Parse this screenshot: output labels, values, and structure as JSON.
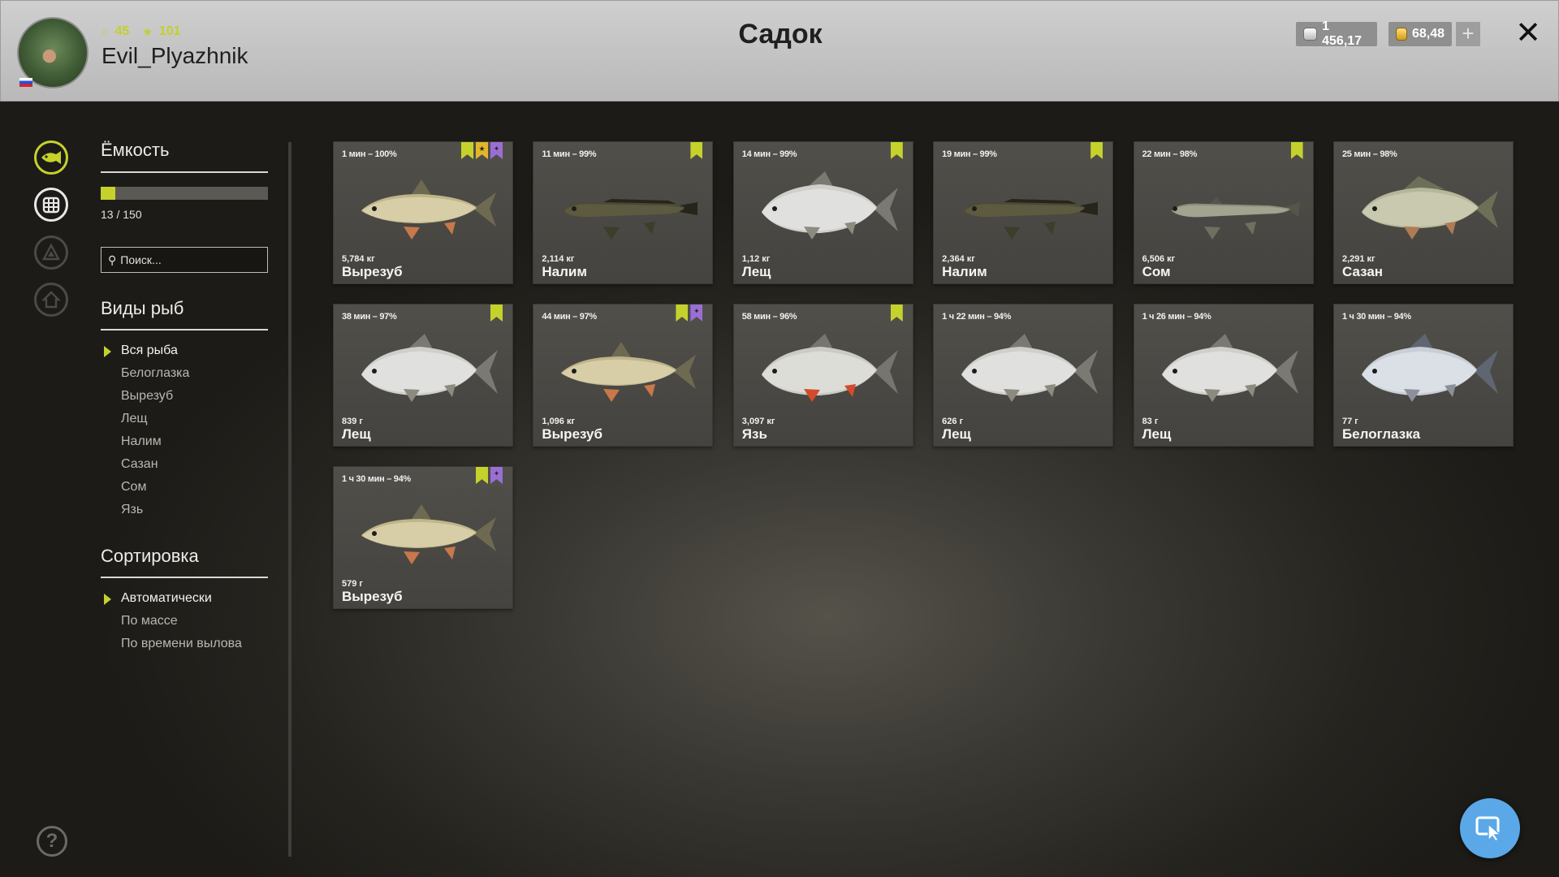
{
  "header": {
    "title": "Садок",
    "username": "Evil_Plyazhnik",
    "level": "45",
    "rating": "101",
    "silver": "1 456,17",
    "gold": "68,48",
    "add_label": "+",
    "close_label": "✕"
  },
  "sidebar": {
    "capacity": {
      "title": "Ёмкость",
      "text": "13 / 150",
      "used": 13,
      "total": 150
    },
    "search": {
      "placeholder": "Поиск..."
    },
    "species": {
      "title": "Виды рыб",
      "items": [
        "Вся рыба",
        "Белоглазка",
        "Вырезуб",
        "Лещ",
        "Налим",
        "Сазан",
        "Сом",
        "Язь"
      ]
    },
    "sort": {
      "title": "Сортировка",
      "items": [
        "Автоматически",
        "По массе",
        "По времени вылова"
      ]
    },
    "help_label": "?"
  },
  "fish": [
    {
      "time": "1 мин – 100%",
      "weight": "5,784 кг",
      "name": "Вырезуб",
      "badges": [
        "green",
        "gold",
        "purple"
      ],
      "kind": "vyrezub"
    },
    {
      "time": "11 мин – 99%",
      "weight": "2,114 кг",
      "name": "Налим",
      "badges": [
        "green"
      ],
      "kind": "nalim"
    },
    {
      "time": "14 мин – 99%",
      "weight": "1,12 кг",
      "name": "Лещ",
      "badges": [
        "green"
      ],
      "kind": "leshch"
    },
    {
      "time": "19 мин – 99%",
      "weight": "2,364 кг",
      "name": "Налим",
      "badges": [
        "green"
      ],
      "kind": "nalim"
    },
    {
      "time": "22 мин – 98%",
      "weight": "6,506 кг",
      "name": "Сом",
      "badges": [
        "green"
      ],
      "kind": "som"
    },
    {
      "time": "25 мин – 98%",
      "weight": "2,291 кг",
      "name": "Сазан",
      "badges": [],
      "kind": "sazan"
    },
    {
      "time": "38 мин – 97%",
      "weight": "839 г",
      "name": "Лещ",
      "badges": [
        "green"
      ],
      "kind": "leshch"
    },
    {
      "time": "44 мин – 97%",
      "weight": "1,096 кг",
      "name": "Вырезуб",
      "badges": [
        "green",
        "purple"
      ],
      "kind": "vyrezub"
    },
    {
      "time": "58 мин – 96%",
      "weight": "3,097 кг",
      "name": "Язь",
      "badges": [
        "green"
      ],
      "kind": "yaz"
    },
    {
      "time": "1 ч 22 мин – 94%",
      "weight": "626 г",
      "name": "Лещ",
      "badges": [],
      "kind": "leshch"
    },
    {
      "time": "1 ч 26 мин – 94%",
      "weight": "83 г",
      "name": "Лещ",
      "badges": [],
      "kind": "leshch"
    },
    {
      "time": "1 ч 30 мин – 94%",
      "weight": "77 г",
      "name": "Белоглазка",
      "badges": [],
      "kind": "beloglazka"
    },
    {
      "time": "1 ч 30 мин – 94%",
      "weight": "579 г",
      "name": "Вырезуб",
      "badges": [
        "green",
        "purple"
      ],
      "kind": "vyrezub"
    }
  ],
  "colors": {
    "accent": "#c5d22c",
    "badge_green": "#c5d22c",
    "badge_gold": "#e3b62a",
    "badge_purple": "#9a6ed2",
    "cursor_button": "#5aa8e8"
  },
  "icons": {
    "rail": [
      "fish-icon",
      "keepnet-icon",
      "tackle-icon",
      "home-icon"
    ],
    "level": "circle-icon",
    "rating": "star-icon",
    "silver": "silver-coin-icon",
    "gold": "gold-coin-icon",
    "search": "search-icon",
    "help": "help-icon",
    "cursor": "cursor-mode-icon"
  }
}
